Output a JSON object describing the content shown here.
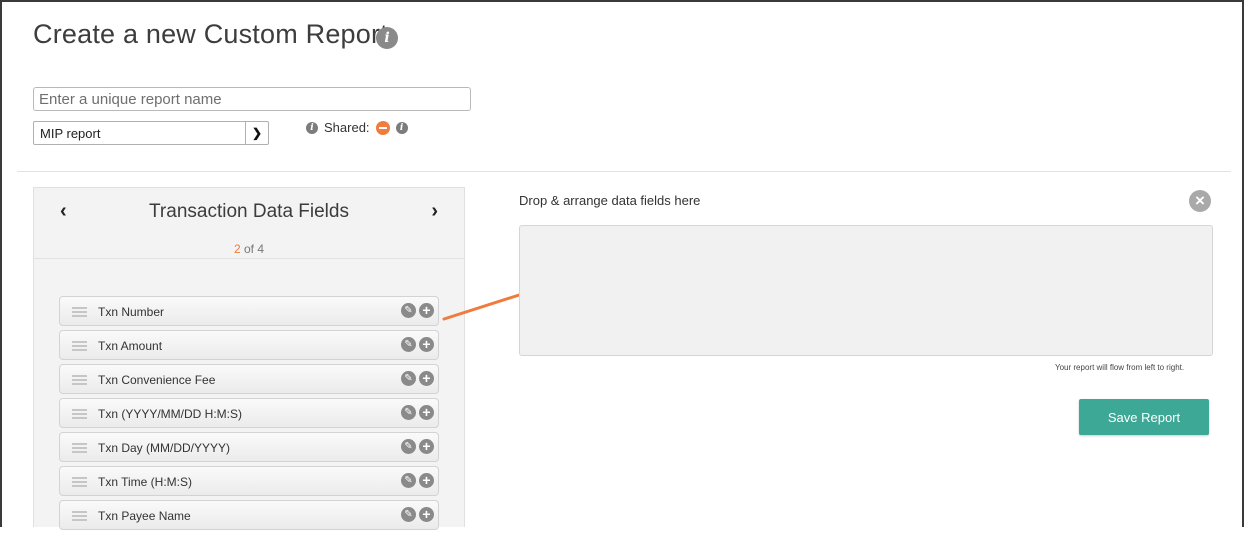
{
  "header": {
    "title": "Create a new Custom Report"
  },
  "form": {
    "report_name_placeholder": "Enter a unique report name",
    "report_type_selected": "MIP report",
    "shared_label": "Shared:"
  },
  "fields_panel": {
    "title": "Transaction Data Fields",
    "page_current": "2",
    "page_rest": " of 4",
    "prev_label": "‹",
    "next_label": "›",
    "fields": [
      {
        "label": "Txn Number"
      },
      {
        "label": "Txn Amount"
      },
      {
        "label": "Txn Convenience Fee"
      },
      {
        "label": "Txn (YYYY/MM/DD H:M:S)"
      },
      {
        "label": "Txn Day (MM/DD/YYYY)"
      },
      {
        "label": "Txn Time (H:M:S)"
      },
      {
        "label": "Txn Payee Name"
      }
    ]
  },
  "drop_area": {
    "label": "Drop & arrange data fields here",
    "flow_note": "Your report will flow from left to right."
  },
  "actions": {
    "save_label": "Save Report"
  },
  "colors": {
    "accent": "#ef7b3e",
    "save_button": "#3ea896",
    "arrow": "#ef7b3e"
  }
}
